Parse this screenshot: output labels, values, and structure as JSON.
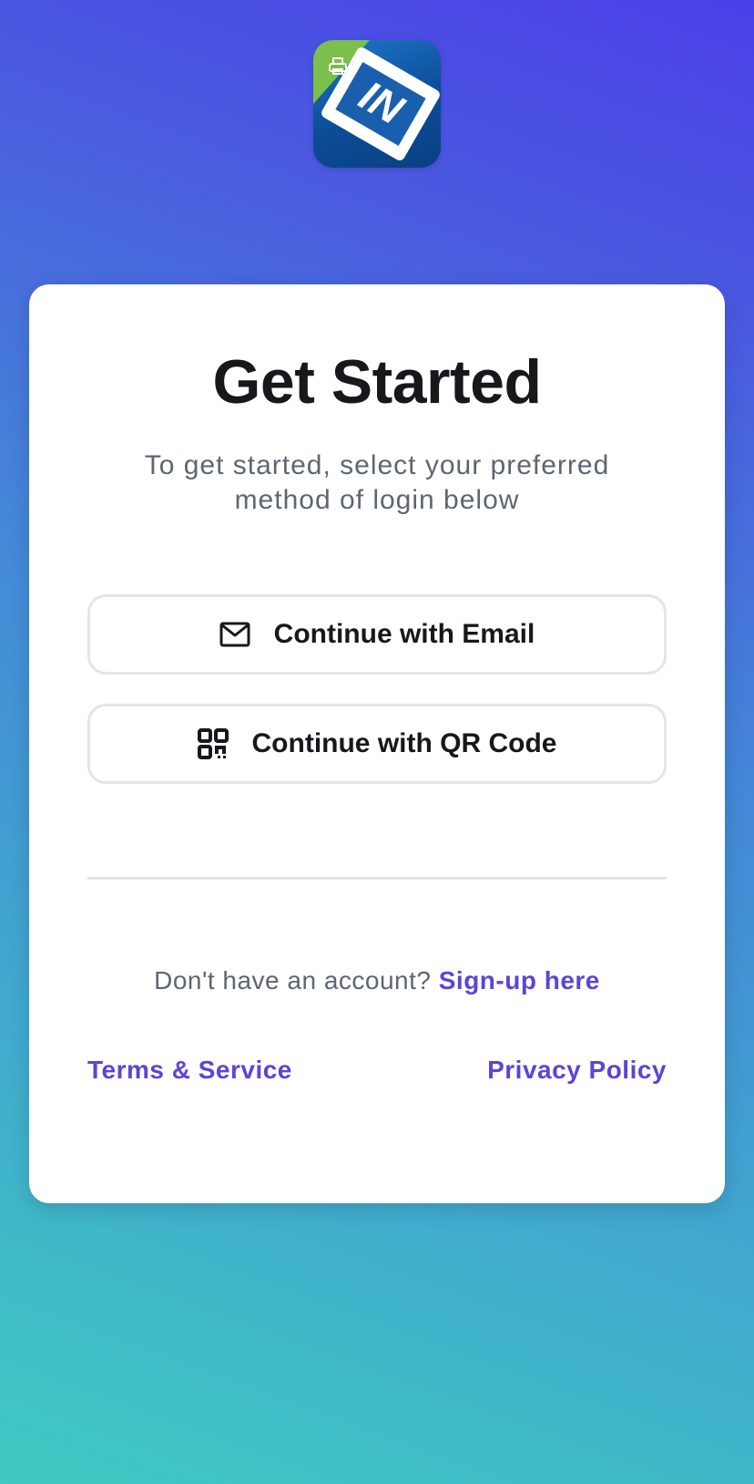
{
  "app": {
    "logo_icon": "app-logo-icon",
    "logo_letters": "IN"
  },
  "main": {
    "title": "Get Started",
    "subtitle": "To get started, select your preferred method of login below"
  },
  "buttons": {
    "email": {
      "label": "Continue with Email",
      "icon": "mail-icon"
    },
    "qr": {
      "label": "Continue with QR Code",
      "icon": "qr-code-icon"
    }
  },
  "signup": {
    "prompt": "Don't have an account?",
    "link": "Sign-up here"
  },
  "footer": {
    "terms": "Terms & Service",
    "privacy": "Privacy Policy"
  },
  "colors": {
    "accent": "#5a45d6",
    "gradient_top": "#4b3fe8",
    "gradient_bottom": "#3fc9c2",
    "text_primary": "#16181c",
    "text_muted": "#5d6670"
  }
}
